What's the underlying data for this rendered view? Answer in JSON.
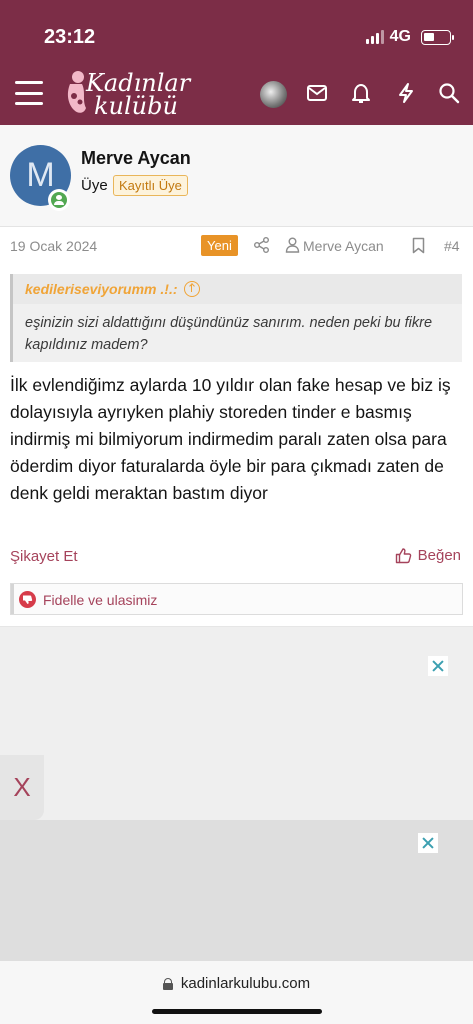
{
  "status": {
    "time": "23:12",
    "network": "4G"
  },
  "header": {
    "logo_line1": "Kadınlar",
    "logo_line2": "kulübü"
  },
  "post": {
    "username": "Merve Aycan",
    "avatar_letter": "M",
    "role": "Üye",
    "badge": "Kayıtlı Üye",
    "date": "19 Ocak 2024",
    "new_badge": "Yeni",
    "author": "Merve Aycan",
    "number": "#4",
    "quote": {
      "author": "kedileriseviyorumm .!.:",
      "text": "eşinizin sizi aldattığını düşündünüz sanırım. neden peki bu fikre kapıldınız madem?"
    },
    "message": "İlk evlendiğimz aylarda 10 yıldır olan fake hesap ve biz iş dolayısıyla ayrıyken plahiy storeden tinder e basmış indirmiş mi bilmiyorum indirmedim paralı zaten olsa para öderdim diyor faturalarda öyle bir para çıkmadı zaten de denk geldi meraktan bastım diyor",
    "report_label": "Şikayet Et",
    "like_label": "Beğen",
    "reactions_text": "Fidelle ve ulasimiz"
  },
  "ads": {
    "side_tab_label": "X"
  },
  "browser": {
    "url": "kadinlarkulubu.com"
  },
  "colors": {
    "header_bg": "#7c2d47",
    "accent": "#a5435b",
    "quote_author": "#f0a437",
    "new_badge": "#e89327",
    "avatar_bg": "#3f6fa6"
  }
}
